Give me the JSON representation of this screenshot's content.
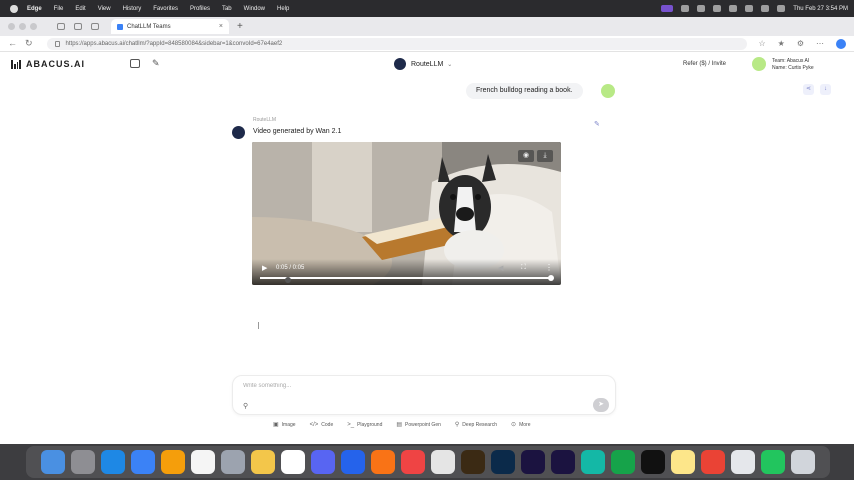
{
  "menubar": {
    "app_name": "Edge",
    "items": [
      "File",
      "Edit",
      "View",
      "History",
      "Favorites",
      "Profiles",
      "Tab",
      "Window",
      "Help"
    ],
    "datetime": "Thu Feb 27  3:54 PM"
  },
  "browser": {
    "tab_title": "ChatLLM Teams",
    "new_tab": "+",
    "url": "https://apps.abacus.ai/chatllm/?appId=848580084&sidebar=1&convoId=67e4aef2"
  },
  "app": {
    "logo_text": "ABACUS.AI",
    "model_name": "RouteLLM",
    "refer_label": "Refer ($) / Invite",
    "user_team": "Team: Abacus AI",
    "user_name": "Name: Curtis Pyke"
  },
  "conversation": {
    "user_message": "French bulldog reading a book.",
    "bot_name": "RouteLLM",
    "bot_message": "Video generated by Wan 2.1",
    "video": {
      "time": "0:05 / 0:05",
      "progress": 1.0
    }
  },
  "composer": {
    "placeholder": "Write something...",
    "tools": [
      {
        "icon": "▣",
        "label": "Image"
      },
      {
        "icon": "</>",
        "label": "Code"
      },
      {
        "icon": ">_",
        "label": "Playground"
      },
      {
        "icon": "▤",
        "label": "Powerpoint Gen"
      },
      {
        "icon": "⚲",
        "label": "Deep Research"
      },
      {
        "icon": "⊙",
        "label": "More"
      }
    ]
  },
  "dock": {
    "apps": [
      {
        "name": "finder",
        "color": "#4a90e2"
      },
      {
        "name": "launchpad",
        "color": "#8e8e93"
      },
      {
        "name": "safari",
        "color": "#1e88e5"
      },
      {
        "name": "mail",
        "color": "#3b82f6"
      },
      {
        "name": "photos",
        "color": "#f59e0b"
      },
      {
        "name": "calendar",
        "color": "#f5f5f5"
      },
      {
        "name": "settings",
        "color": "#9ca3af"
      },
      {
        "name": "notes",
        "color": "#f3c64a"
      },
      {
        "name": "reminders",
        "color": "#ffffff"
      },
      {
        "name": "discord",
        "color": "#5865f2"
      },
      {
        "name": "app-store",
        "color": "#2563eb"
      },
      {
        "name": "vlc",
        "color": "#f97316"
      },
      {
        "name": "music",
        "color": "#ef4444"
      },
      {
        "name": "chatgpt",
        "color": "#e5e5e5"
      },
      {
        "name": "illustrator",
        "color": "#3b2a14"
      },
      {
        "name": "photoshop",
        "color": "#0b2a4a"
      },
      {
        "name": "after-effects",
        "color": "#1b1340"
      },
      {
        "name": "premiere",
        "color": "#1b1340"
      },
      {
        "name": "edge",
        "color": "#14b8a6"
      },
      {
        "name": "numbers",
        "color": "#16a34a"
      },
      {
        "name": "capcut",
        "color": "#111111"
      },
      {
        "name": "notes-2",
        "color": "#fde68a"
      },
      {
        "name": "chrome",
        "color": "#ea4335"
      },
      {
        "name": "utility",
        "color": "#e5e7eb"
      },
      {
        "name": "messages",
        "color": "#22c55e"
      },
      {
        "name": "trash",
        "color": "#d1d5db"
      }
    ]
  }
}
